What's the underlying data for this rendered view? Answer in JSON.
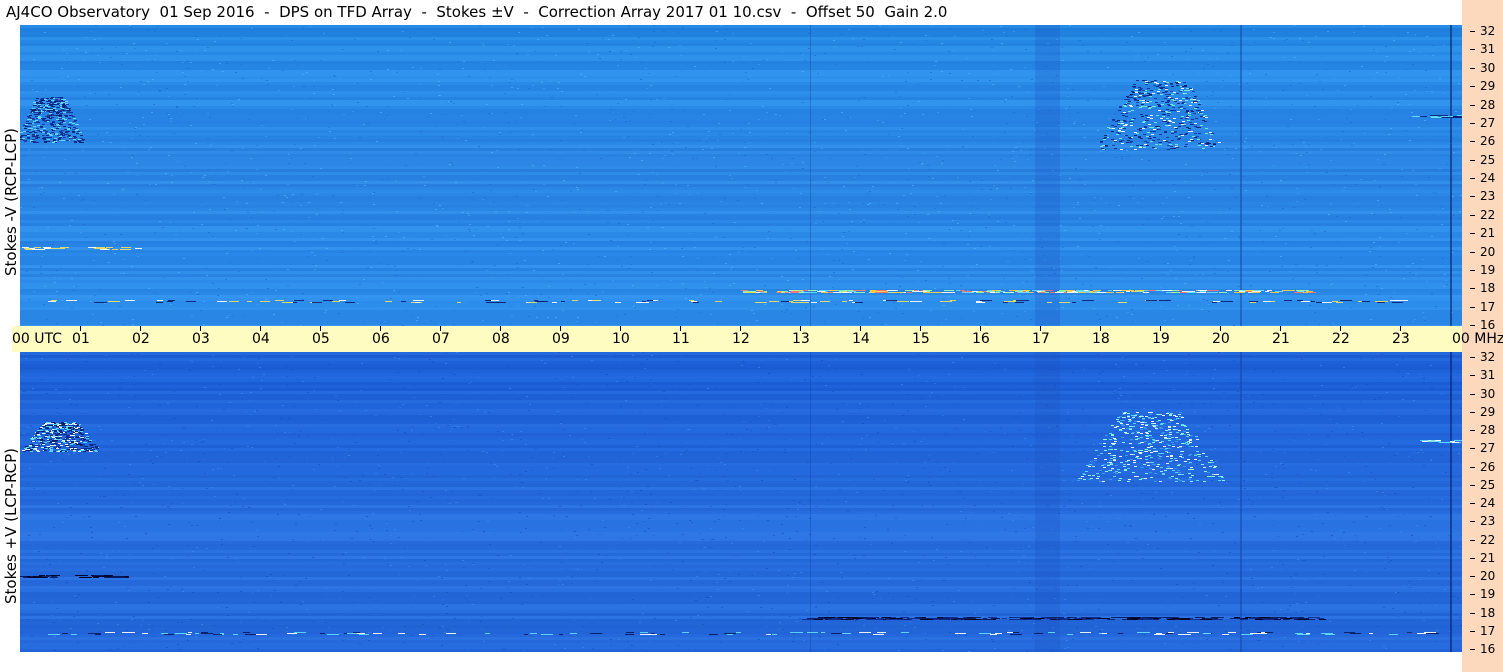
{
  "header": {
    "title": "AJ4CO Observatory  01 Sep 2016  -  DPS on TFD Array  -  Stokes ±V  -  Correction Array 2017 01 10.csv  -  Offset 50  Gain 2.0"
  },
  "panels": {
    "top_label": "Stokes -V (RCP-LCP)",
    "bottom_label": "Stokes +V (LCP-RCP)"
  },
  "axis": {
    "utc_first_label": "00 UTC",
    "utc_ticks": [
      "01",
      "02",
      "03",
      "04",
      "05",
      "06",
      "07",
      "08",
      "09",
      "10",
      "11",
      "12",
      "13",
      "14",
      "15",
      "16",
      "17",
      "18",
      "19",
      "20",
      "21",
      "22",
      "23"
    ],
    "utc_last_label": "00 MHz",
    "mhz_ticks": [
      "32",
      "31",
      "30",
      "29",
      "28",
      "27",
      "26",
      "25",
      "24",
      "23",
      "22",
      "21",
      "20",
      "19",
      "18",
      "17",
      "16"
    ]
  },
  "colors": {
    "utc_bar": "#fefcc0",
    "right_margin": "#fcd9bd",
    "top_panel_base": "#2a88e8",
    "bottom_panel_base": "#2468dc"
  },
  "chart_data": [
    {
      "type": "heatmap",
      "title": "Stokes -V (RCP-LCP)",
      "x_axis": "UTC hour",
      "xlim": [
        0,
        24
      ],
      "y_axis": "MHz",
      "ylim": [
        16,
        32
      ],
      "grid": false
    },
    {
      "type": "heatmap",
      "title": "Stokes +V (LCP-RCP)",
      "x_axis": "UTC hour",
      "xlim": [
        0,
        24
      ],
      "y_axis": "MHz",
      "ylim": [
        16,
        32
      ],
      "grid": false
    }
  ]
}
